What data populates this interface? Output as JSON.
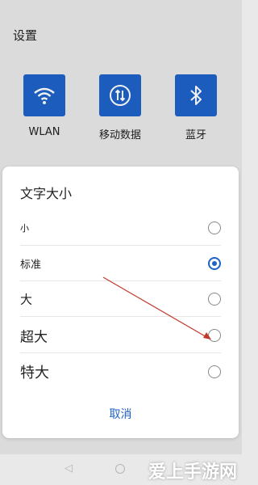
{
  "settings": {
    "title": "设置",
    "tiles": [
      {
        "label": "WLAN",
        "icon": "wifi-icon"
      },
      {
        "label": "移动数据",
        "icon": "mobile-data-icon"
      },
      {
        "label": "蓝牙",
        "icon": "bluetooth-icon"
      }
    ]
  },
  "dialog": {
    "title": "文字大小",
    "options": [
      {
        "label": "小",
        "selected": false
      },
      {
        "label": "标准",
        "selected": true
      },
      {
        "label": "大",
        "selected": false
      },
      {
        "label": "超大",
        "selected": false
      },
      {
        "label": "特大",
        "selected": false
      }
    ],
    "cancel_label": "取消"
  },
  "nav": {
    "back_icon": "back-icon",
    "home_icon": "home-icon"
  },
  "watermark": "爱上手游网",
  "colors": {
    "accent": "#1d62c8",
    "arrow": "#c0392b"
  }
}
